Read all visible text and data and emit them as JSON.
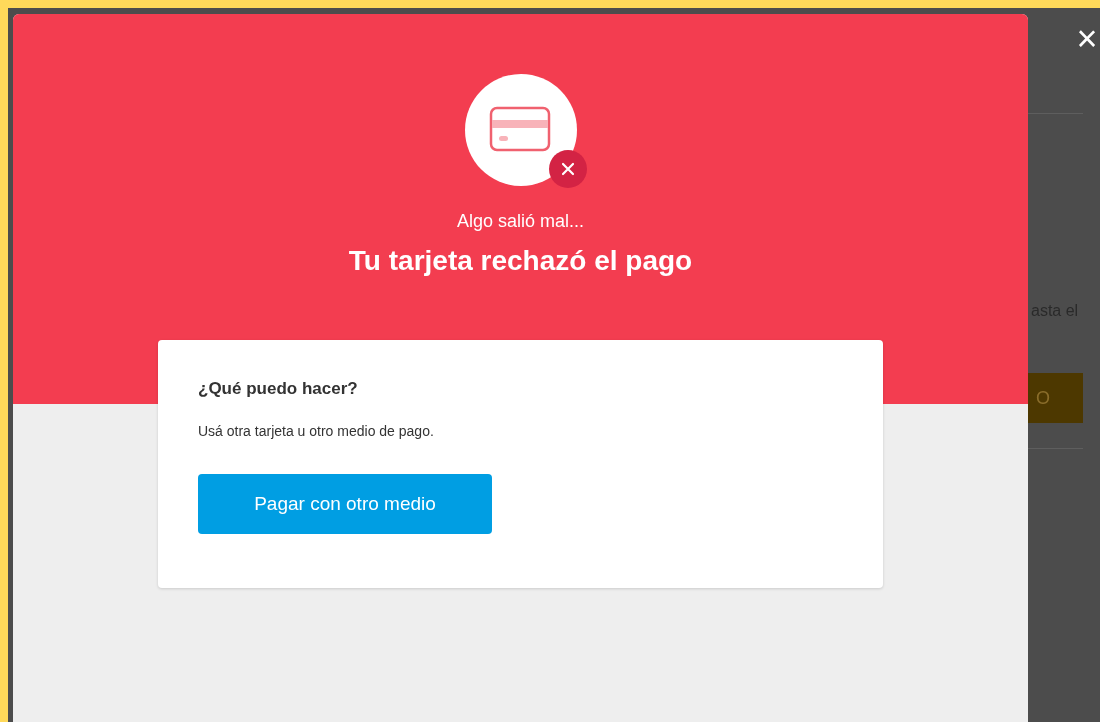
{
  "background": {
    "text_fragment": "asta el",
    "button_label": "O"
  },
  "close_button": {
    "label": "×"
  },
  "dialog": {
    "subtitle": "Algo salió mal...",
    "title": "Tu tarjeta rechazó el pago",
    "card": {
      "heading": "¿Qué puedo hacer?",
      "text": "Usá otra tarjeta u otro medio de pago.",
      "button": "Pagar con otro medio"
    }
  }
}
